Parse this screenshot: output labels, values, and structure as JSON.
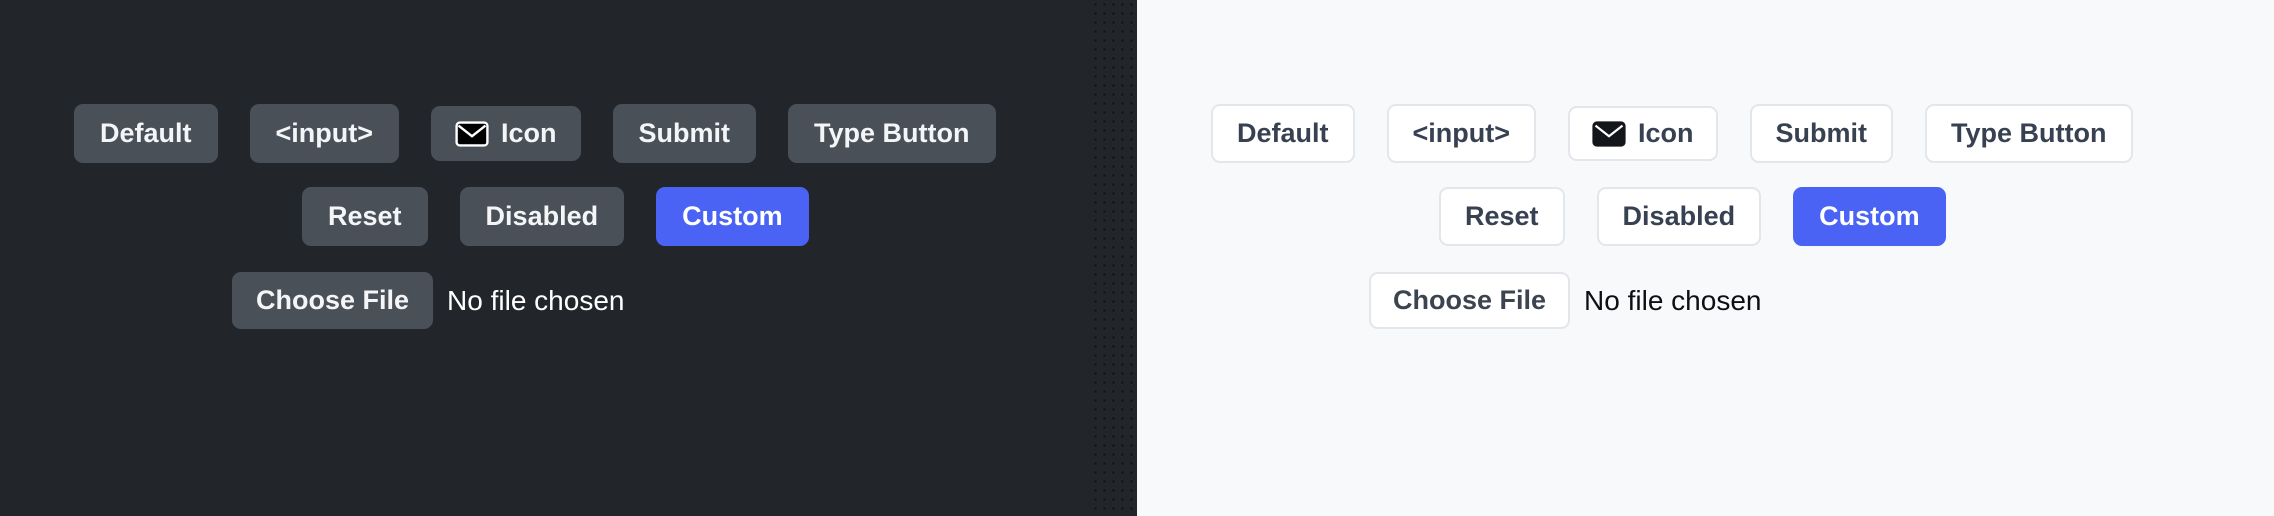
{
  "theme_colors": {
    "dark_background": "#22262b",
    "light_background": "#f8f9fb",
    "dark_button_fill": "#4a5058",
    "dark_button_text": "#f3f5f7",
    "light_button_fill": "#ffffff",
    "light_button_border": "#e3e6ea",
    "light_button_text": "#374151",
    "custom_accent": "#4a63f5",
    "custom_accent_text": "#ffffff",
    "envelope_icon_dark_fill": "#000000",
    "envelope_icon_dark_stroke": "#ffffff",
    "envelope_icon_light_fill": "#13161a"
  },
  "panels": [
    {
      "id": "dark",
      "rows": [
        {
          "id": "row-1",
          "buttons": [
            {
              "label": "Default",
              "variant": "default",
              "icon": null
            },
            {
              "label": "<input>",
              "variant": "default",
              "icon": null
            },
            {
              "label": "Icon",
              "variant": "default",
              "icon": "envelope-icon"
            },
            {
              "label": "Submit",
              "variant": "default",
              "icon": null
            },
            {
              "label": "Type Button",
              "variant": "default",
              "icon": null
            }
          ]
        },
        {
          "id": "row-2",
          "buttons": [
            {
              "label": "Reset",
              "variant": "default",
              "icon": null
            },
            {
              "label": "Disabled",
              "variant": "default",
              "icon": null
            },
            {
              "label": "Custom",
              "variant": "custom",
              "icon": null
            }
          ]
        },
        {
          "id": "row-3",
          "file_input": {
            "button_label": "Choose File",
            "status_text": "No file chosen"
          }
        }
      ]
    },
    {
      "id": "light",
      "rows": [
        {
          "id": "row-1",
          "buttons": [
            {
              "label": "Default",
              "variant": "default",
              "icon": null
            },
            {
              "label": "<input>",
              "variant": "default",
              "icon": null
            },
            {
              "label": "Icon",
              "variant": "default",
              "icon": "envelope-icon"
            },
            {
              "label": "Submit",
              "variant": "default",
              "icon": null
            },
            {
              "label": "Type Button",
              "variant": "default",
              "icon": null
            }
          ]
        },
        {
          "id": "row-2",
          "buttons": [
            {
              "label": "Reset",
              "variant": "default",
              "icon": null
            },
            {
              "label": "Disabled",
              "variant": "default",
              "icon": null
            },
            {
              "label": "Custom",
              "variant": "custom",
              "icon": null
            }
          ]
        },
        {
          "id": "row-3",
          "file_input": {
            "button_label": "Choose File",
            "status_text": "No file chosen"
          }
        }
      ]
    }
  ]
}
